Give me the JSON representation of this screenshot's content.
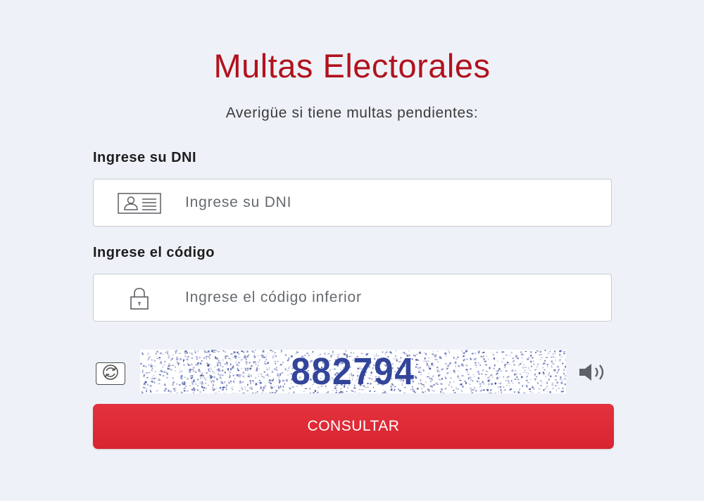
{
  "header": {
    "title": "Multas Electorales",
    "subtitle": "Averigüe si tiene multas pendientes:"
  },
  "form": {
    "dni": {
      "label": "Ingrese su DNI",
      "placeholder": "Ingrese su DNI",
      "icon": "id-card-icon"
    },
    "code": {
      "label": "Ingrese el código",
      "placeholder": "Ingrese el código inferior",
      "icon": "lock-icon"
    },
    "captcha": {
      "text": "882794",
      "refresh_icon": "refresh-icon",
      "audio_icon": "speaker-icon"
    },
    "submit_label": "CONSULTAR"
  },
  "colors": {
    "title": "#b2121e",
    "button": "#d82431",
    "background": "#eef2f8",
    "captcha_text": "#32459a"
  }
}
